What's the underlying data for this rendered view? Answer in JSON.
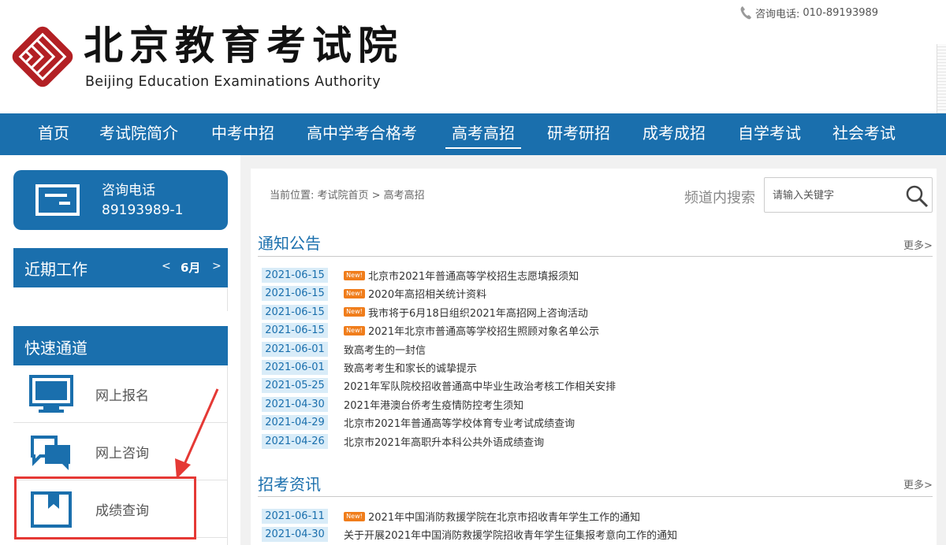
{
  "header": {
    "logo_cn": "北京教育考试院",
    "logo_en": "Beijing Education Examinations Authority",
    "phone_label": "咨询电话:",
    "phone_number": "010-89193989"
  },
  "nav": [
    "首页",
    "考试院简介",
    "中考中招",
    "高中学考合格考",
    "高考高招",
    "研考研招",
    "成考成招",
    "自学考试",
    "社会考试"
  ],
  "sidebar": {
    "phone_box": {
      "label": "咨询电话",
      "number": "89193989-1"
    },
    "recent": {
      "title": "近期工作",
      "prev": "<",
      "month": "6月",
      "next": ">"
    },
    "quick": {
      "title": "快速通道",
      "items": [
        {
          "label": "网上报名",
          "icon": "monitor-icon"
        },
        {
          "label": "网上咨询",
          "icon": "chat-icon"
        },
        {
          "label": "成绩查询",
          "icon": "bookmark-icon"
        }
      ]
    }
  },
  "main": {
    "breadcrumb": "当前位置: 考试院首页 > 高考高招",
    "search_label": "频道内搜索",
    "search_placeholder": "请输入关键字",
    "more_label": "更多>",
    "new_badge": "New!",
    "sections": [
      {
        "title": "通知公告",
        "items": [
          {
            "date": "2021-06-15",
            "new": true,
            "title": "北京市2021年普通高等学校招生志愿填报须知"
          },
          {
            "date": "2021-06-15",
            "new": true,
            "title": "2020年高招相关统计资料"
          },
          {
            "date": "2021-06-15",
            "new": true,
            "title": "我市将于6月18日组织2021年高招网上咨询活动"
          },
          {
            "date": "2021-06-15",
            "new": true,
            "title": "2021年北京市普通高等学校招生照顾对象名单公示"
          },
          {
            "date": "2021-06-01",
            "new": false,
            "title": "致高考生的一封信"
          },
          {
            "date": "2021-06-01",
            "new": false,
            "title": "致高考考生和家长的诚挚提示"
          },
          {
            "date": "2021-05-25",
            "new": false,
            "title": "2021年军队院校招收普通高中毕业生政治考核工作相关安排"
          },
          {
            "date": "2021-04-30",
            "new": false,
            "title": "2021年港澳台侨考生疫情防控考生须知"
          },
          {
            "date": "2021-04-29",
            "new": false,
            "title": "北京市2021年普通高等学校体育专业考试成绩查询"
          },
          {
            "date": "2021-04-26",
            "new": false,
            "title": "北京市2021年高职升本科公共外语成绩查询"
          }
        ]
      },
      {
        "title": "招考资讯",
        "items": [
          {
            "date": "2021-06-11",
            "new": true,
            "title": "2021年中国消防救援学院在北京市招收青年学生工作的通知"
          },
          {
            "date": "2021-04-30",
            "new": false,
            "title": "关于开展2021年中国消防救援学院招收青年学生征集报考意向工作的通知"
          }
        ]
      }
    ]
  },
  "colors": {
    "brand": "#1a6fad",
    "new_badge": "#f07d1b",
    "date_bg": "#d9ecf8",
    "highlight": "#e53935"
  }
}
